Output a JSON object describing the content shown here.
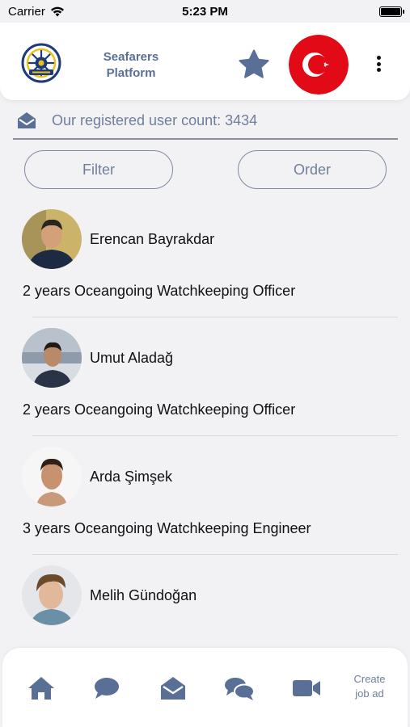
{
  "status_bar": {
    "carrier": "Carrier",
    "time": "5:23 PM"
  },
  "header": {
    "brand": "Seafarers Platform",
    "logo_icon": "seafarers-platform-logo",
    "favorites_icon": "star-icon",
    "language_flag": "turkey-flag",
    "menu_icon": "more-vertical-icon"
  },
  "stats": {
    "text": "Our registered user count: 3434",
    "icon": "envelope-open-icon"
  },
  "controls": {
    "filter_label": "Filter",
    "order_label": "Order"
  },
  "users": [
    {
      "name": "Erencan Bayrakdar",
      "experience": "2 years Oceangoing Watchkeeping Officer"
    },
    {
      "name": "Umut Aladağ",
      "experience": "2 years Oceangoing Watchkeeping Officer"
    },
    {
      "name": "Arda Şimşek",
      "experience": "3 years Oceangoing Watchkeeping Engineer"
    },
    {
      "name": "Melih Gündoğan",
      "experience": ""
    }
  ],
  "tabbar": {
    "items": [
      "home-icon",
      "chat-bubble-icon",
      "envelope-open-icon",
      "group-chat-icon",
      "video-camera-icon"
    ],
    "create_job_ad": "Create job ad"
  },
  "colors": {
    "accent": "#5a6f96",
    "muted_text": "#6f7f9a",
    "flag_red": "#e30a17",
    "background": "#f2f2f4"
  }
}
